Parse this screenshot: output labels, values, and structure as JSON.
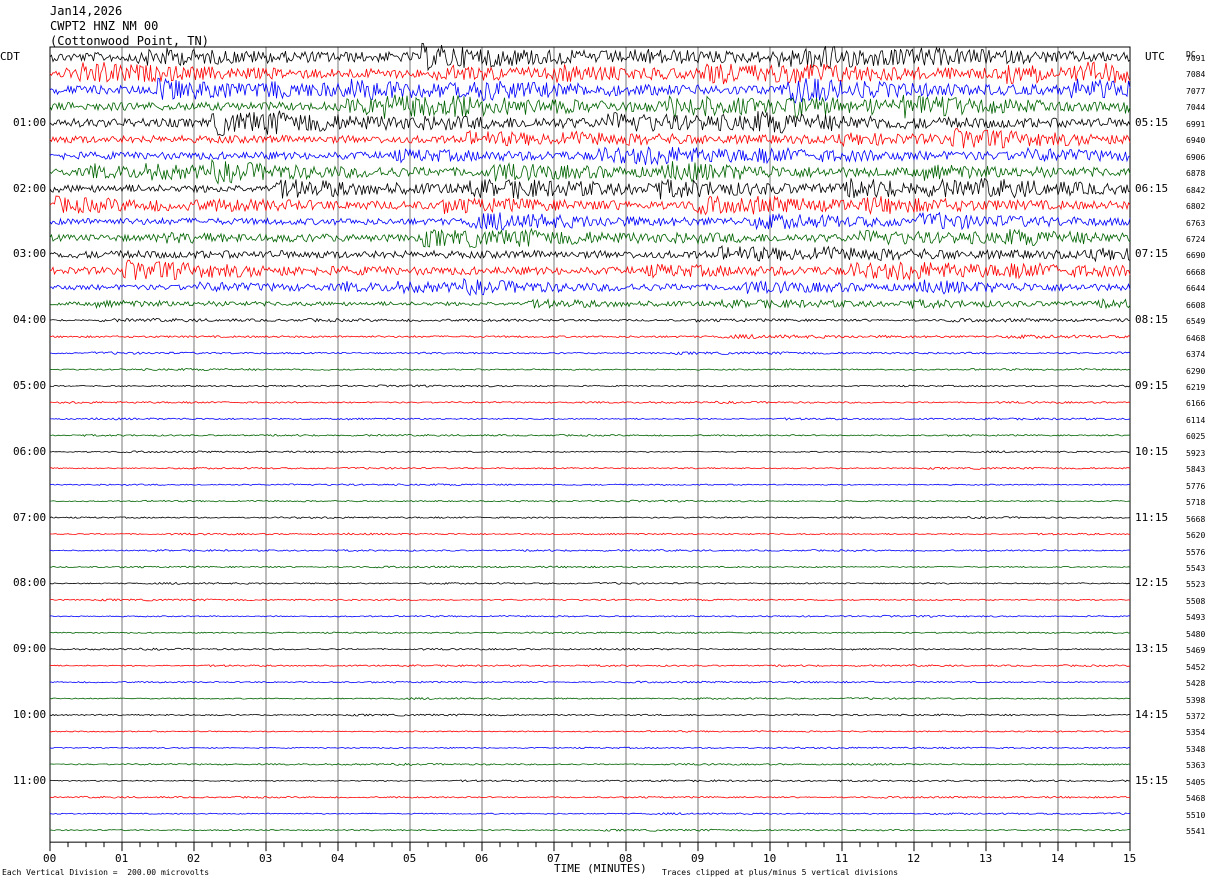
{
  "header": {
    "date": "Jan14,2026",
    "station": "CWPT2 HNZ NM 00",
    "location": "(Cottonwood Point, TN)"
  },
  "left_tz": "CDT",
  "right_tz": "UTC",
  "dc_label": "DC",
  "footer": {
    "scale_note": "Each Vertical Division =  200.00 microvolts",
    "x_title": "TIME (MINUTES)",
    "clip_note": "Traces clipped at plus/minus 5 vertical divisions"
  },
  "chart_data": {
    "type": "line",
    "title": "",
    "xlabel": "TIME (MINUTES)",
    "xlim": [
      0,
      15
    ],
    "x_ticks": [
      "00",
      "01",
      "02",
      "03",
      "04",
      "05",
      "06",
      "07",
      "08",
      "09",
      "10",
      "11",
      "12",
      "13",
      "14",
      "15"
    ],
    "trace_colors": [
      "#000000",
      "#ff0000",
      "#0000ff",
      "#006400"
    ],
    "left_hour_labels": [
      "01:00",
      "02:00",
      "03:00",
      "04:00",
      "05:00",
      "06:00",
      "07:00",
      "08:00",
      "09:00",
      "10:00",
      "11:00"
    ],
    "right_hour_labels": [
      "05:15",
      "06:15",
      "07:15",
      "08:15",
      "09:15",
      "10:15",
      "11:15",
      "12:15",
      "13:15",
      "14:15",
      "15:15"
    ],
    "dc_offsets": [
      "7091",
      "7084",
      "7077",
      "7044",
      "6991",
      "6940",
      "6906",
      "6878",
      "6842",
      "6802",
      "6763",
      "6724",
      "6690",
      "6668",
      "6644",
      "6608",
      "6549",
      "6468",
      "6374",
      "6290",
      "6219",
      "6166",
      "6114",
      "6025",
      "5923",
      "5843",
      "5776",
      "5718",
      "5668",
      "5620",
      "5576",
      "5543",
      "5523",
      "5508",
      "5493",
      "5480",
      "5469",
      "5452",
      "5428",
      "5398",
      "5372",
      "5354",
      "5348",
      "5363",
      "5405",
      "5468",
      "5510",
      "5541"
    ],
    "trace_activity": [
      1.0,
      0.95,
      0.95,
      0.9,
      0.95,
      0.8,
      0.8,
      0.8,
      0.8,
      0.75,
      0.7,
      0.7,
      0.8,
      0.8,
      0.55,
      0.35,
      0.12,
      0.14,
      0.08,
      0.07,
      0.06,
      0.06,
      0.06,
      0.05,
      0.05,
      0.05,
      0.05,
      0.05,
      0.05,
      0.05,
      0.05,
      0.05,
      0.05,
      0.05,
      0.05,
      0.05,
      0.05,
      0.05,
      0.05,
      0.05,
      0.05,
      0.05,
      0.05,
      0.05,
      0.05,
      0.05,
      0.05,
      0.05
    ],
    "grid": true,
    "legend": "none"
  }
}
